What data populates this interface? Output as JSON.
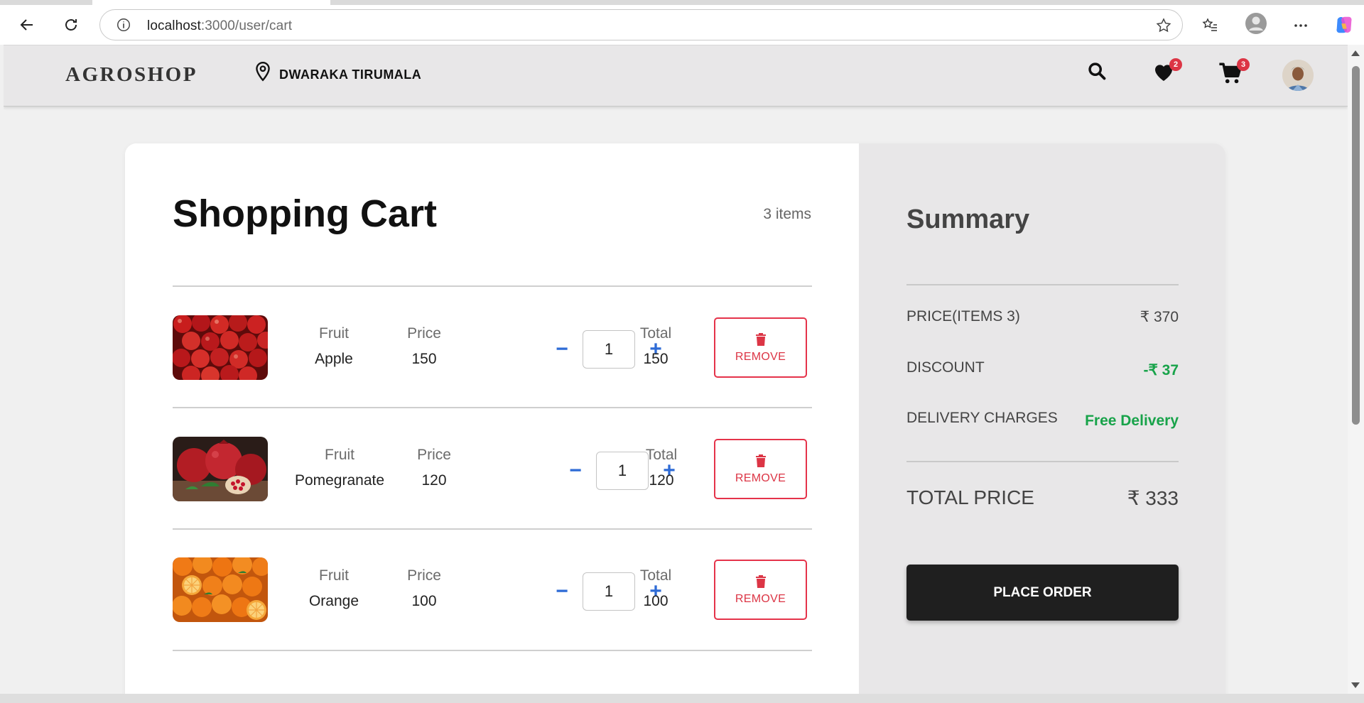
{
  "browser": {
    "url_host": "localhost",
    "url_path": ":3000/user/cart"
  },
  "header": {
    "logo": "AGROSHOP",
    "location": "DWARAKA TIRUMALA",
    "wishlist_count": "2",
    "cart_count": "3"
  },
  "cart": {
    "title": "Shopping Cart",
    "count_label": "3 items",
    "fruit_label": "Fruit",
    "price_label": "Price",
    "total_label": "Total",
    "remove_label": "REMOVE",
    "minus": "−",
    "plus": "+",
    "items": [
      {
        "name": "Apple",
        "price": "150",
        "qty": "1",
        "total": "150",
        "image": "apples"
      },
      {
        "name": "Pomegranate",
        "price": "120",
        "qty": "1",
        "total": "120",
        "image": "pomegranates"
      },
      {
        "name": "Orange",
        "price": "100",
        "qty": "1",
        "total": "100",
        "image": "oranges"
      }
    ]
  },
  "summary": {
    "title": "Summary",
    "price_label": "PRICE(ITEMS 3)",
    "price_value": "₹ 370",
    "discount_label": "DISCOUNT",
    "discount_value": "-₹ 37",
    "delivery_label": "DELIVERY CHARGES",
    "delivery_value": "Free Delivery",
    "total_label": "TOTAL PRICE",
    "total_value": "₹ 333",
    "place_order": "PLACE ORDER"
  },
  "colors": {
    "accent_blue": "#2e6bd6",
    "remove_red": "#dc3545",
    "discount_green": "#18a34a",
    "button_dark": "#1f1f1f"
  }
}
